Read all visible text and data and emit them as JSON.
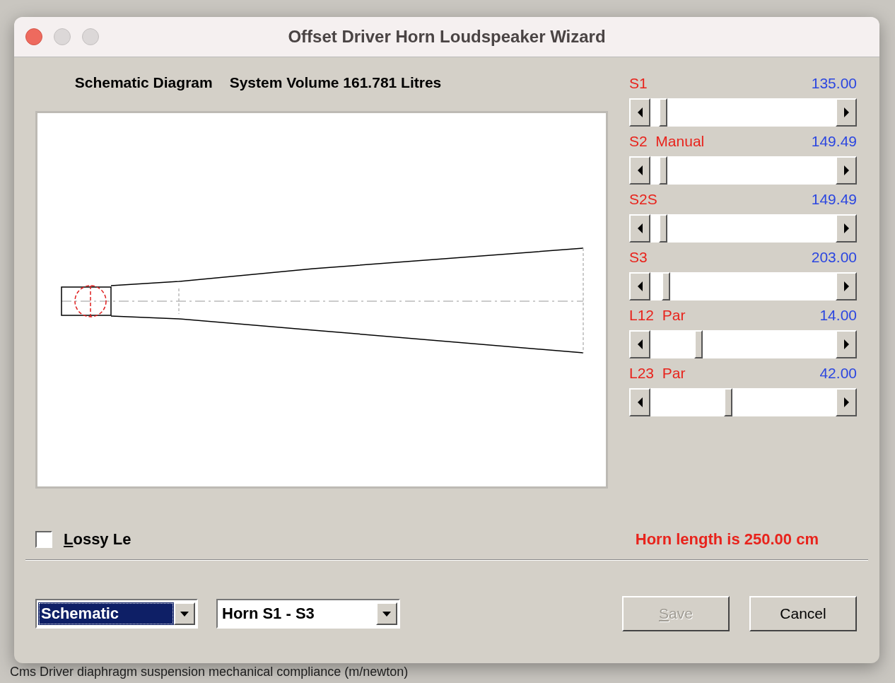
{
  "window": {
    "title": "Offset Driver Horn Loudspeaker Wizard"
  },
  "diagram": {
    "heading": "Schematic Diagram",
    "volume": "System Volume 161.781 Litres"
  },
  "sliders": [
    {
      "label": "S1",
      "value": "135.00",
      "level": 0.05
    },
    {
      "label": "S2  Manual",
      "value": "149.49",
      "level": 0.05
    },
    {
      "label": "S2S",
      "value": "149.49",
      "level": 0.05
    },
    {
      "label": "S3",
      "value": "203.00",
      "level": 0.065
    },
    {
      "label": "L12  Par",
      "value": "14.00",
      "level": 0.25
    },
    {
      "label": "L23  Par",
      "value": "42.00",
      "level": 0.42
    }
  ],
  "lossy": {
    "label": "Lossy Le",
    "checked": false
  },
  "horn_length": "Horn length is 250.00 cm",
  "view_select": {
    "value": "Schematic"
  },
  "section_select": {
    "value": "Horn S1 - S3"
  },
  "buttons": [
    {
      "label": "Save",
      "disabled": true
    },
    {
      "label": "Cancel",
      "disabled": false
    }
  ],
  "status_bar": "Cms  Driver diaphragm suspension mechanical compliance  (m/newton)"
}
